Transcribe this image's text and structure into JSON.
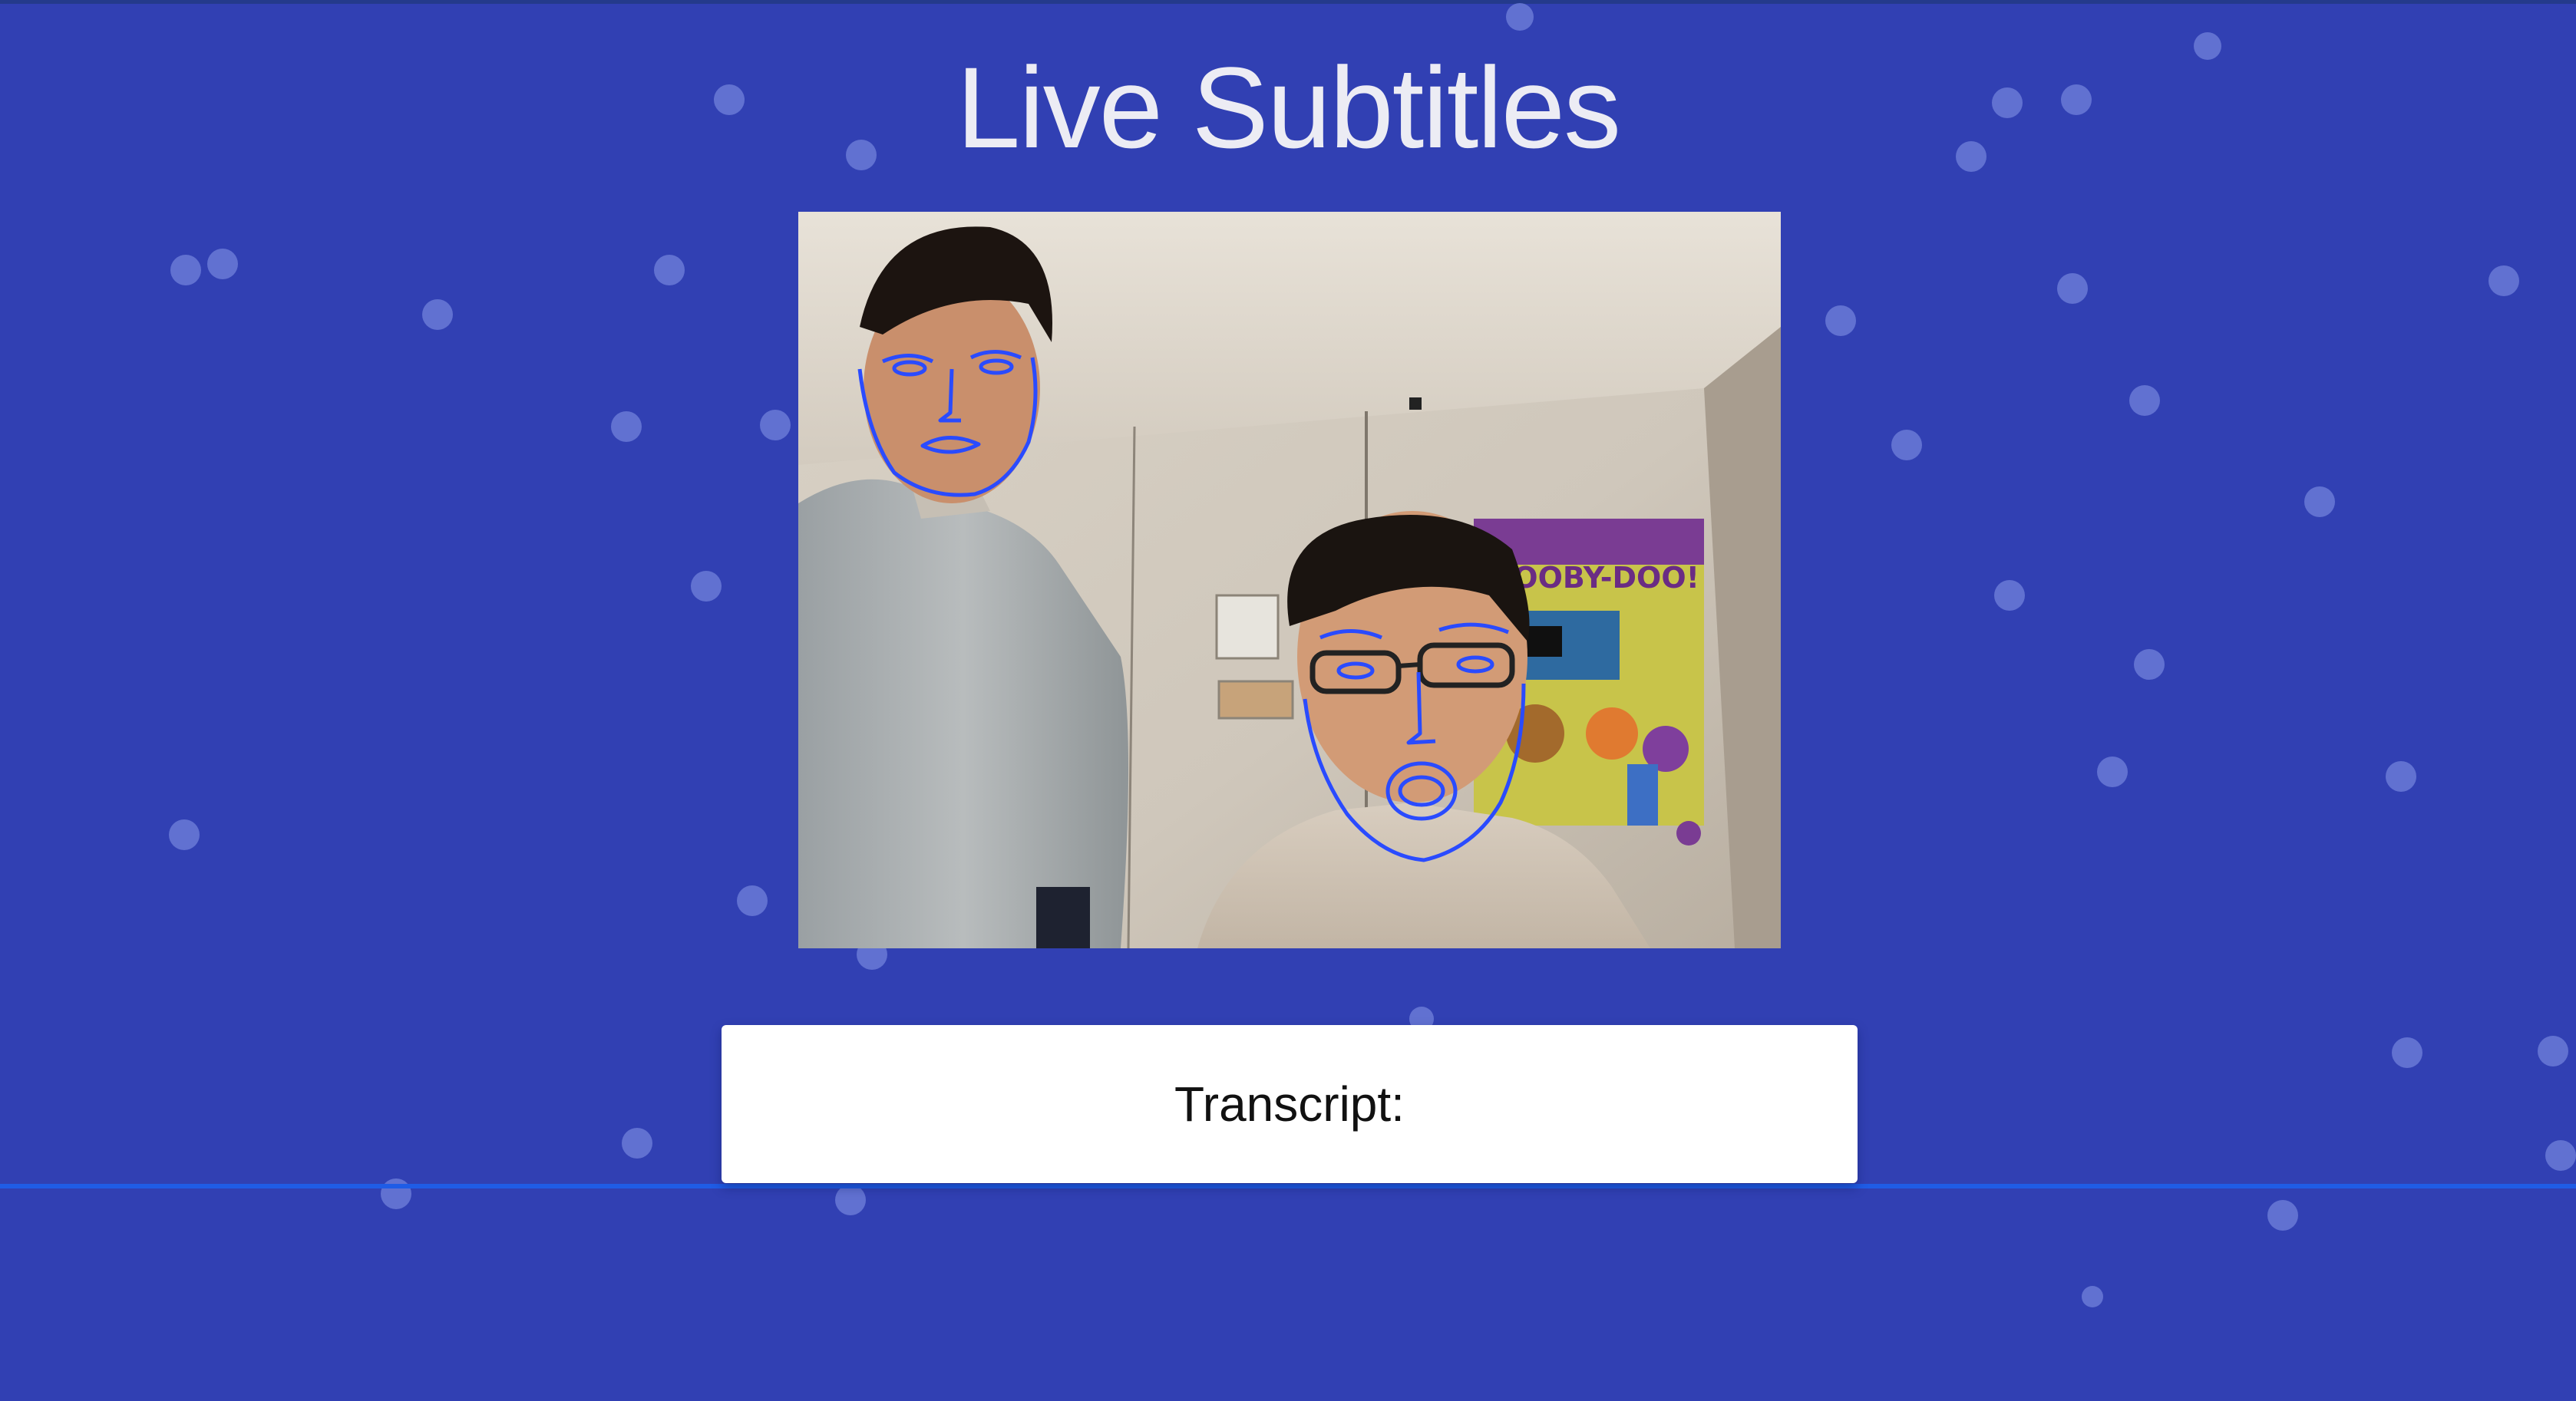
{
  "page": {
    "title": "Live Subtitles"
  },
  "video": {
    "poster_text": "SCOOBY-DOO!"
  },
  "transcript": {
    "label": "Transcript:"
  },
  "colors": {
    "background": "#3140b3",
    "face_mesh": "#2a4bff",
    "scan_line": "#1f5ce6",
    "title": "#ececf4"
  }
}
